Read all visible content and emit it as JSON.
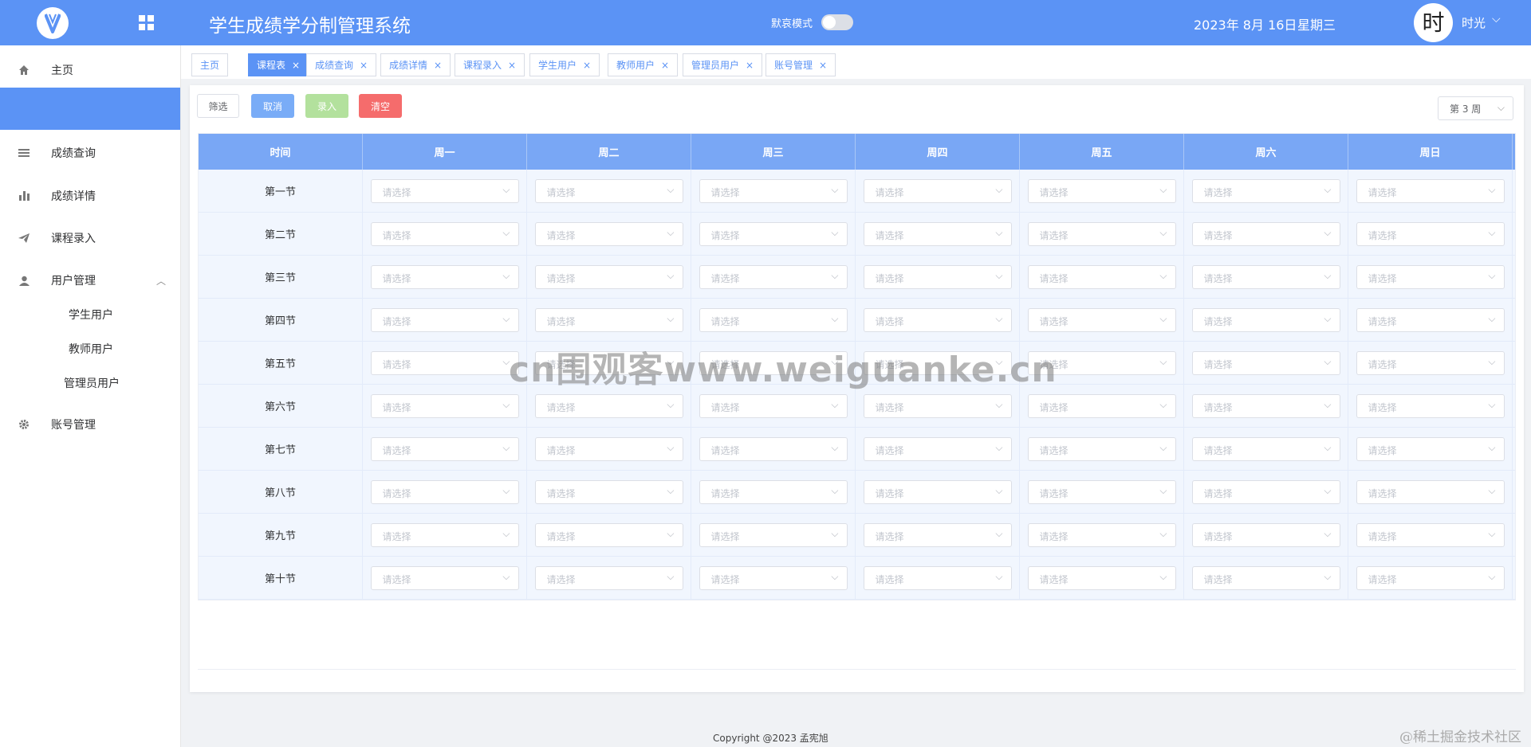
{
  "header": {
    "title": "学生成绩学分制管理系统",
    "dark_mode_label": "默哀模式",
    "date": "2023年 8月 16日",
    "weekday": "星期三",
    "avatar_text": "时",
    "username": "时光"
  },
  "sidebar": {
    "items": [
      {
        "label": "主页",
        "icon": "home-icon"
      },
      {
        "label": "",
        "icon": ""
      },
      {
        "label": "成绩查询",
        "icon": "list-icon"
      },
      {
        "label": "成绩详情",
        "icon": "bar-chart-icon"
      },
      {
        "label": "课程录入",
        "icon": "send-icon"
      },
      {
        "label": "用户管理",
        "icon": "user-icon"
      },
      {
        "label": "账号管理",
        "icon": "gear-icon"
      }
    ],
    "sub_items": [
      "学生用户",
      "教师用户",
      "管理员用户"
    ]
  },
  "tabs": [
    "主页",
    "课程表",
    "成绩查询",
    "成绩详情",
    "课程录入",
    "学生用户",
    "教师用户",
    "管理员用户",
    "账号管理"
  ],
  "active_tab": "课程表",
  "toolbar": {
    "filter": "筛选",
    "cancel": "取消",
    "enter": "录入",
    "clear": "清空",
    "week": "第 3 周"
  },
  "table": {
    "headers": [
      "时间",
      "周一",
      "周二",
      "周三",
      "周四",
      "周五",
      "周六",
      "周日"
    ],
    "periods": [
      "第一节",
      "第二节",
      "第三节",
      "第四节",
      "第五节",
      "第六节",
      "第七节",
      "第八节",
      "第九节",
      "第十节"
    ],
    "placeholder": "请选择"
  },
  "footer": "Copyright @2023 孟宪旭",
  "watermark": "cn围观客www.weiguanke.cn",
  "corner_mark": "@稀土掘金技术社区",
  "colors": {
    "primary": "#5b93f5",
    "danger": "#f56c6c",
    "success_light": "#b3e19d"
  }
}
